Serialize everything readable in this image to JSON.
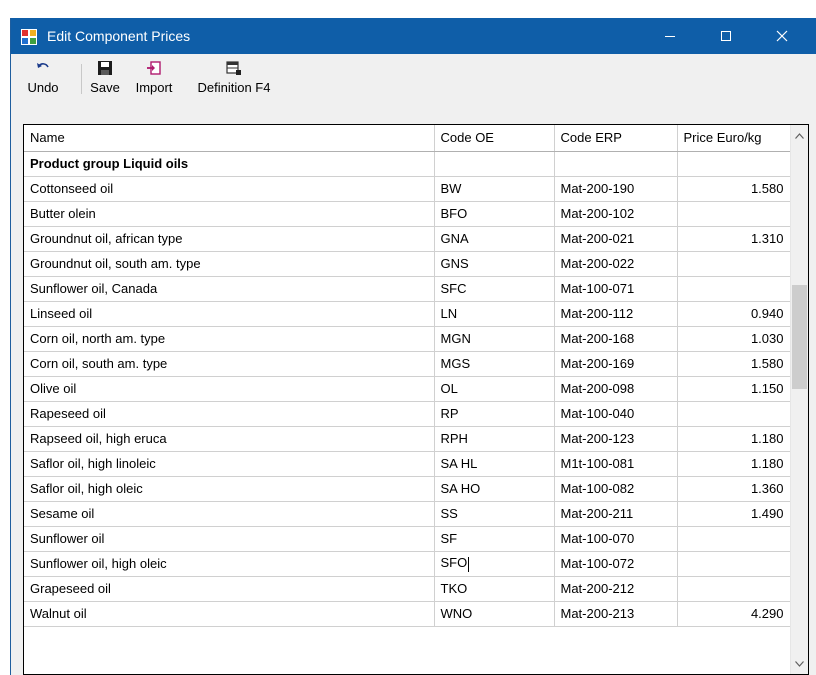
{
  "window": {
    "title": "Edit Component Prices",
    "accent": "#0f5ea8"
  },
  "toolbar": {
    "undo_label": "Undo",
    "save_label": "Save",
    "import_label": "Import",
    "definition_label": "Definition F4"
  },
  "grid": {
    "columns": [
      "Name",
      "Code OE",
      "Code ERP",
      "Price Euro/kg"
    ],
    "group_row": "Product group Liquid oils",
    "rows": [
      {
        "name": "Cottonseed oil",
        "code_oe": "BW",
        "code_erp": "Mat-200-190",
        "price": "1.580"
      },
      {
        "name": "Butter olein",
        "code_oe": "BFO",
        "code_erp": "Mat-200-102",
        "price": ""
      },
      {
        "name": "Groundnut oil, african type",
        "code_oe": "GNA",
        "code_erp": "Mat-200-021",
        "price": "1.310"
      },
      {
        "name": "Groundnut oil, south am. type",
        "code_oe": "GNS",
        "code_erp": "Mat-200-022",
        "price": ""
      },
      {
        "name": "Sunflower oil, Canada",
        "code_oe": "SFC",
        "code_erp": "Mat-100-071",
        "price": ""
      },
      {
        "name": "Linseed oil",
        "code_oe": "LN",
        "code_erp": "Mat-200-112",
        "price": "0.940"
      },
      {
        "name": "Corn oil, north am. type",
        "code_oe": "MGN",
        "code_erp": "Mat-200-168",
        "price": "1.030"
      },
      {
        "name": "Corn oil, south am. type",
        "code_oe": "MGS",
        "code_erp": "Mat-200-169",
        "price": "1.580"
      },
      {
        "name": "Olive oil",
        "code_oe": "OL",
        "code_erp": "Mat-200-098",
        "price": "1.150"
      },
      {
        "name": "Rapeseed oil",
        "code_oe": "RP",
        "code_erp": "Mat-100-040",
        "price": ""
      },
      {
        "name": "Rapseed oil, high eruca",
        "code_oe": "RPH",
        "code_erp": "Mat-200-123",
        "price": "1.180"
      },
      {
        "name": "Saflor oil, high linoleic",
        "code_oe": "SA HL",
        "code_erp": "M1t-100-081",
        "price": "1.180"
      },
      {
        "name": "Saflor oil, high oleic",
        "code_oe": "SA HO",
        "code_erp": "Mat-100-082",
        "price": "1.360"
      },
      {
        "name": "Sesame oil",
        "code_oe": "SS",
        "code_erp": "Mat-200-211",
        "price": "1.490"
      },
      {
        "name": "Sunflower oil",
        "code_oe": "SF",
        "code_erp": "Mat-100-070",
        "price": ""
      },
      {
        "name": "Sunflower oil,  high oleic",
        "code_oe": "SFO",
        "code_erp": "Mat-100-072",
        "price": ""
      },
      {
        "name": "Grapeseed oil",
        "code_oe": "TKO",
        "code_erp": "Mat-200-212",
        "price": ""
      },
      {
        "name": "Walnut oil",
        "code_oe": "WNO",
        "code_erp": "Mat-200-213",
        "price": "4.290"
      }
    ]
  }
}
